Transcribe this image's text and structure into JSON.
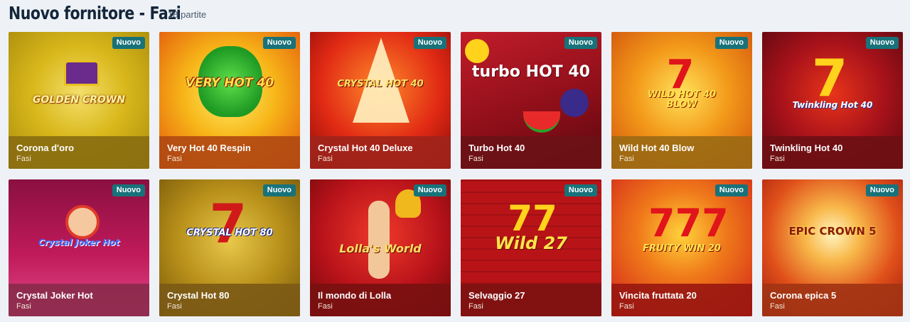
{
  "header": {
    "title": "Nuovo fornitore - Fazi",
    "count": "18 partite"
  },
  "badge_label": "Nuovo",
  "games": [
    {
      "name": "Corona d'oro",
      "provider": "Fasi",
      "logo": "GOLDEN CROWN",
      "icon": "crown-icon",
      "caption_color": "#8a6e10"
    },
    {
      "name": "Very Hot 40 Respin",
      "provider": "Fasi",
      "logo": "VERY HOT 40",
      "icon": "clover-icon",
      "caption_color": "#b14a12"
    },
    {
      "name": "Crystal Hot 40 Deluxe",
      "provider": "Fasi",
      "logo": "CRYSTAL HOT 40",
      "icon": "star-icon",
      "caption_color": "#a0241a"
    },
    {
      "name": "Turbo Hot 40",
      "provider": "Fasi",
      "logo": "turbo HOT 40",
      "icon": "fruit-icon",
      "caption_color": "#6b1216"
    },
    {
      "name": "Wild Hot 40 Blow",
      "provider": "Fasi",
      "logo": "WILD HOT 40 BLOW",
      "icon": "seven-icon",
      "caption_color": "#9c6a14"
    },
    {
      "name": "Twinkling Hot 40",
      "provider": "Fasi",
      "logo": "Twinkling Hot 40",
      "icon": "seven-star-icon",
      "caption_color": "#6e1014"
    },
    {
      "name": "Crystal Joker Hot",
      "provider": "Fasi",
      "logo": "Crystal Joker Hot",
      "icon": "joker-icon",
      "caption_color": "#8a2a4a"
    },
    {
      "name": "Crystal Hot 80",
      "provider": "Fasi",
      "logo": "CRYSTAL HOT 80",
      "icon": "seven-icon",
      "caption_color": "#7c5a16"
    },
    {
      "name": "Il mondo di Lolla",
      "provider": "Fasi",
      "logo": "Lolla's World",
      "icon": "bell-icon",
      "caption_color": "#7a1010"
    },
    {
      "name": "Selvaggio 27",
      "provider": "Fasi",
      "logo": "Wild 27",
      "icon": "seven-icon",
      "caption_color": "#7e1212"
    },
    {
      "name": "Vincita fruttata 20",
      "provider": "Fasi",
      "logo": "FRUITY WIN 20",
      "icon": "seven-icon",
      "caption_color": "#9a1810"
    },
    {
      "name": "Corona epica 5",
      "provider": "Fasi",
      "logo": "EPIC CROWN 5",
      "icon": "crown-icon",
      "caption_color": "#a23414"
    }
  ]
}
